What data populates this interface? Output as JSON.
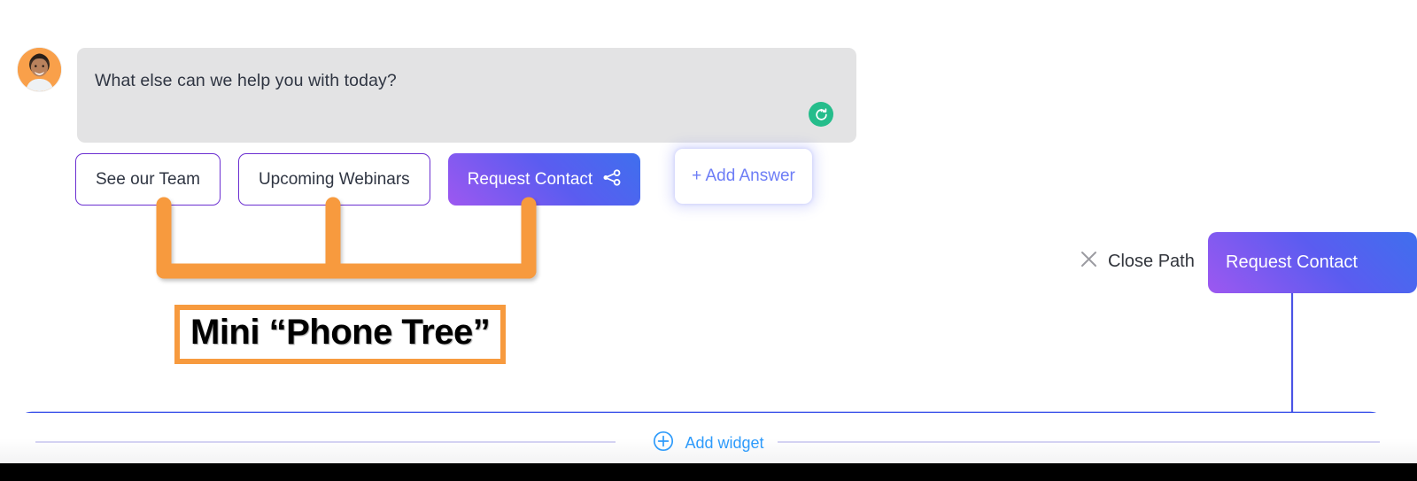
{
  "message": {
    "avatar_alt": "agent-avatar",
    "text": "What else can we help you with today?",
    "refresh_icon": "refresh-icon",
    "bubble_color": "#e3e3e4"
  },
  "answers": {
    "items": [
      {
        "label": "See our Team",
        "style": "outline"
      },
      {
        "label": "Upcoming Webinars",
        "style": "outline"
      },
      {
        "label": "Request Contact",
        "style": "primary",
        "icon": "share-nodes-icon"
      }
    ],
    "add_answer_label": "+ Add Answer",
    "outline_border_color": "#6b2fd1",
    "primary_gradient_from": "#3f6fee",
    "primary_gradient_to": "#9d58f0",
    "add_answer_color": "#6d7df6"
  },
  "annotation": {
    "label": "Mini “Phone Tree”",
    "color": "#f79a3e"
  },
  "path_controls": {
    "close_icon": "close-x-icon",
    "close_label": "Close Path",
    "chip_label": "Request Contact"
  },
  "footer": {
    "add_widget_icon": "plus-circle-icon",
    "add_widget_label": "Add widget",
    "link_color": "#2e9bfb",
    "rule_color": "#d4d2f2"
  },
  "connectors": {
    "color": "#2b44e8"
  }
}
